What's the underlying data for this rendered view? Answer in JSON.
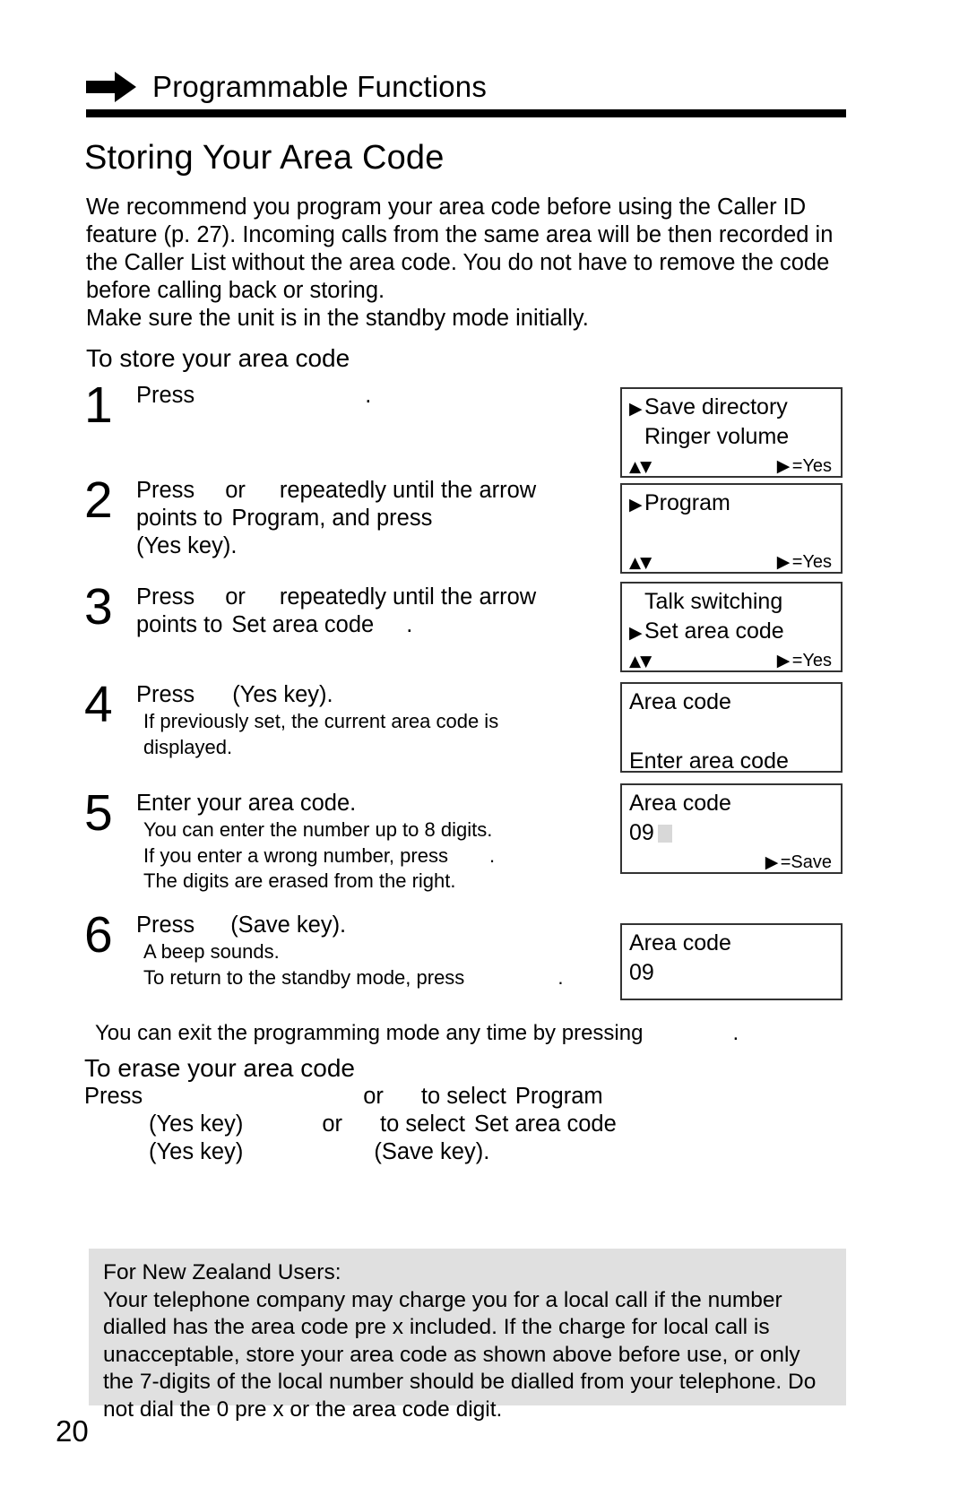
{
  "header": {
    "arrow_icon": "right-arrow-icon",
    "title": "Programmable Functions"
  },
  "section": {
    "title": "Storing Your Area Code"
  },
  "intro": {
    "line1": "We recommend you program your area code before using the Caller ID",
    "line2": "feature (p. 27). Incoming calls from the same area will be then recorded in",
    "line3": "the Caller List without the area code. You do not have to remove the code",
    "line4": "before calling back or storing.",
    "line5": "Make sure the unit is in the standby mode initially."
  },
  "subheads": {
    "store": "To store your area code",
    "erase": "To erase your area code"
  },
  "steps": [
    {
      "num": "1",
      "main_a": "Press",
      "main_b": ".",
      "notes": []
    },
    {
      "num": "2",
      "main_a": "Press",
      "main_b": "or",
      "main_c": "repeatedly until the arrow",
      "line2_a": "points to",
      "line2_b": "Program",
      "line2_c": ", and press",
      "line3": "(Yes key).",
      "notes": []
    },
    {
      "num": "3",
      "main_a": "Press",
      "main_b": "or",
      "main_c": "repeatedly until the arrow",
      "line2_a": "points to",
      "line2_b": "Set area code",
      "line2_c": ".",
      "notes": []
    },
    {
      "num": "4",
      "main_a": "Press",
      "main_b": "(Yes key).",
      "notes": [
        "If previously set, the current area code is",
        "displayed."
      ]
    },
    {
      "num": "5",
      "main_a": "Enter your area code.",
      "notes": [
        "You can enter the number up to 8 digits.",
        "If you enter a wrong number, press",
        "The digits are erased from the right."
      ]
    },
    {
      "num": "6",
      "main_a": "Press",
      "main_b": "(Save key).",
      "notes": [
        "A beep sounds.",
        "To return to the standby mode, press"
      ]
    }
  ],
  "exit_note": "You can exit the programming mode any time by pressing",
  "erase": {
    "line1_a": "Press",
    "line1_b": "or",
    "line1_c": "to select",
    "line1_d": "Program",
    "line2_a": "(Yes key)",
    "line2_b": "or",
    "line2_c": "to select",
    "line2_d": "Set area code",
    "line3_a": "(Yes key)",
    "line3_b": "(Save key)."
  },
  "lcd": {
    "arrow_glyph": "▶",
    "up_glyph": "▲",
    "down_glyph": "▼",
    "b1": {
      "l1": "Save directory",
      "l2": "Ringer volume",
      "l3_right": "=Yes"
    },
    "b2": {
      "l1": "Program",
      "l2": "",
      "l3_right": "=Yes"
    },
    "b3": {
      "l1": "Talk switching",
      "l2": "Set area code",
      "l3_right": "=Yes"
    },
    "b4": {
      "l1": "Area code",
      "l2": "",
      "l3": "Enter area code"
    },
    "b5": {
      "l1": "Area code",
      "l2": "09",
      "l3_right": "=Save"
    },
    "b6": {
      "l1": "Area code",
      "l2": "09"
    }
  },
  "nz_notice": {
    "heading": "For New Zealand Users:",
    "line1": "Your telephone company may charge you for a local call if the number",
    "line2": "dialled has the area code pre x included. If the charge for local call is",
    "line3": "unacceptable, store your area code as shown above before use, or only",
    "line4": "the 7-digits of the local number should be dialled from your telephone. Do",
    "line5": "not dial the  0  pre x or the area code digit."
  },
  "page_number": "20",
  "colors": {
    "ink": "#000000",
    "notice_bg": "#e0e0e0",
    "lcd_border": "#333333",
    "cursor": "#d8d8d8"
  }
}
